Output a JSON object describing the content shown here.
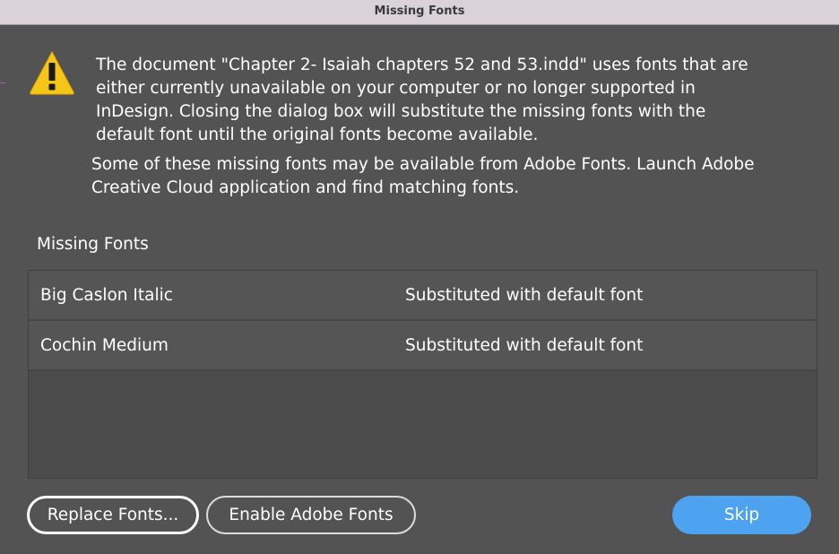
{
  "window": {
    "title": "Missing Fonts"
  },
  "dialog": {
    "message": "The document \"Chapter 2- Isaiah chapters 52 and 53.indd\" uses fonts that are\neither currently unavailable on your computer or no longer supported in\nInDesign. Closing the dialog box will substitute the missing fonts with the\ndefault font until the original fonts become available.",
    "adobe_fonts_message": "Some of these missing fonts may be available from Adobe Fonts. Launch Adobe\nCreative Cloud application and find matching fonts.",
    "section_label": "Missing Fonts",
    "fonts": [
      {
        "name": "Big Caslon Italic",
        "status": "Substituted with default font"
      },
      {
        "name": "Cochin Medium",
        "status": "Substituted with default font"
      }
    ]
  },
  "buttons": {
    "replace_fonts": "Replace Fonts...",
    "enable_adobe_fonts": "Enable Adobe Fonts",
    "skip": "Skip"
  },
  "icons": {
    "warning": "warning-triangle-icon"
  },
  "colors": {
    "background": "#535353",
    "titlebar": "#d9d3d9",
    "warning_yellow": "#f5c518",
    "primary_button": "#4ea3f0"
  }
}
